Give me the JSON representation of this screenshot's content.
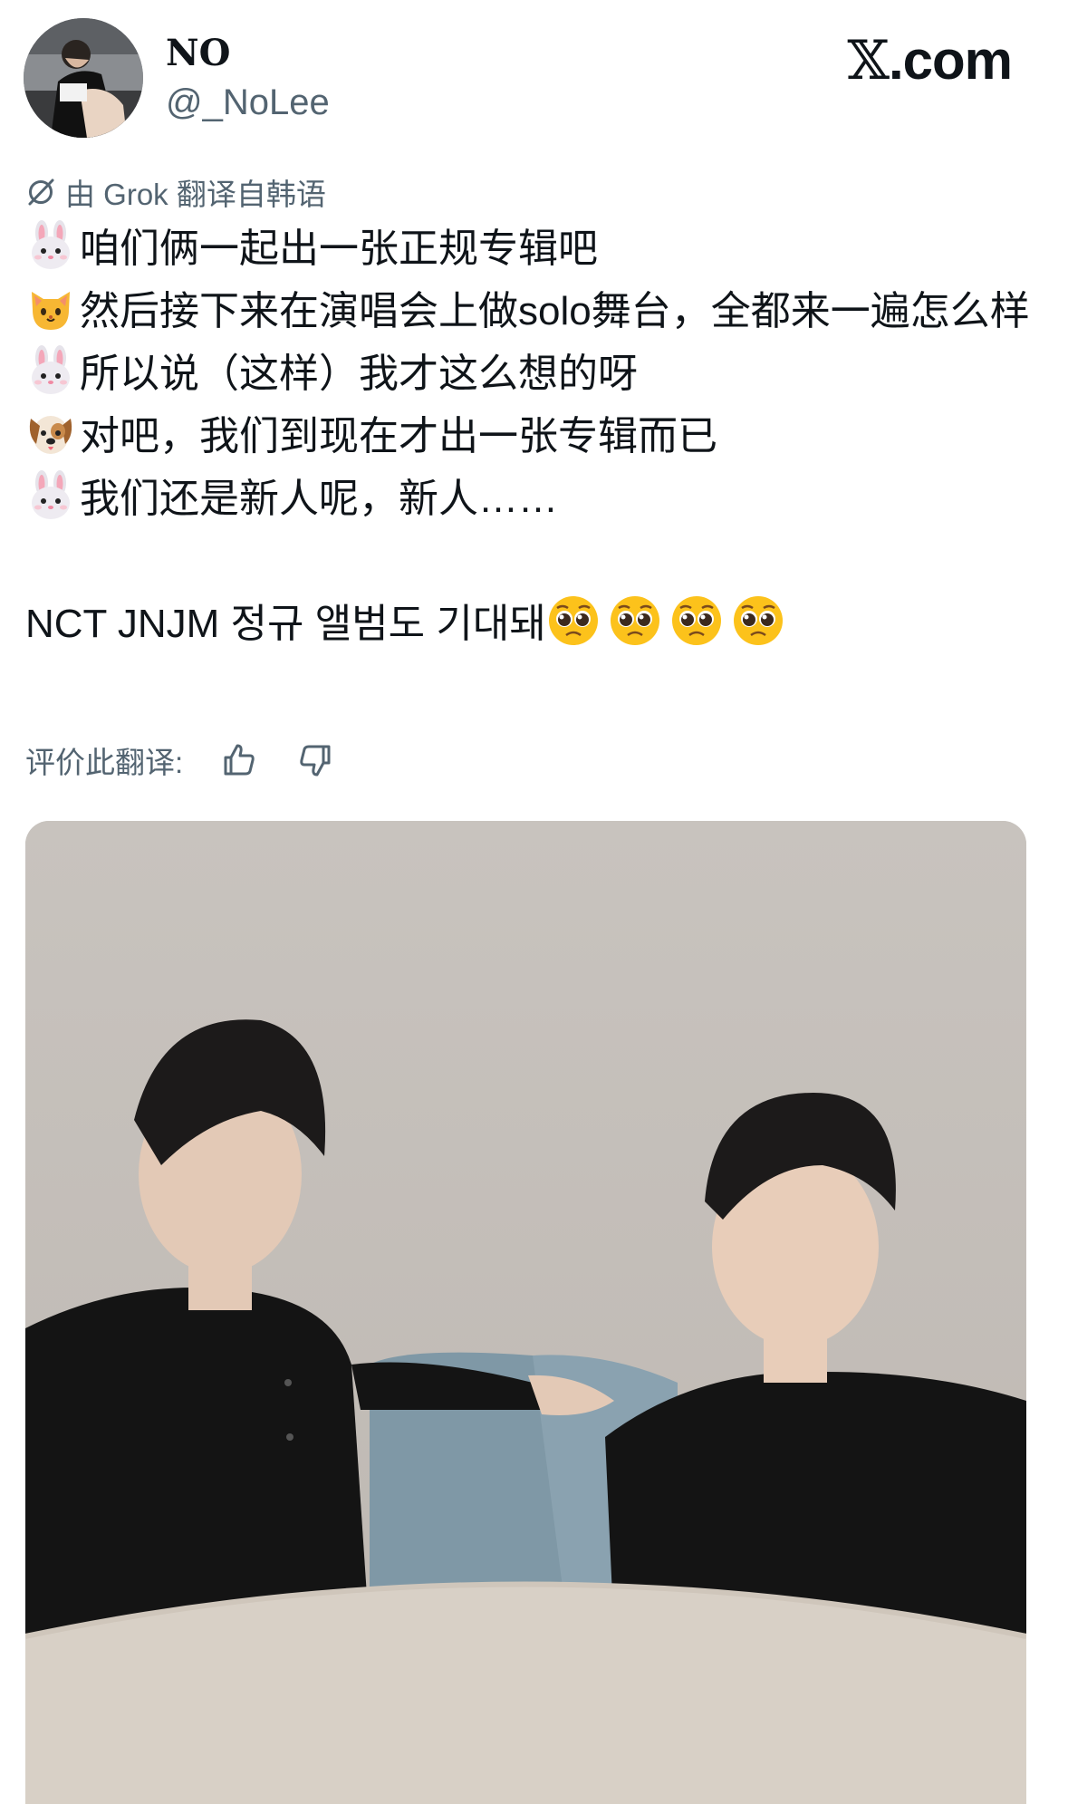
{
  "author": {
    "display_name": "NO",
    "handle": "@_NoLee",
    "avatar_icon": "profile-photo"
  },
  "brand": {
    "mark": "𝕏",
    "suffix": ".com"
  },
  "translation": {
    "note": "由 Grok 翻译自韩语",
    "icon": "grok-icon",
    "rate_label": "评价此翻译:",
    "thumbs_up_icon": "thumbs-up-icon",
    "thumbs_down_icon": "thumbs-down-icon"
  },
  "post": {
    "lines": [
      {
        "emoji": "rabbit-face",
        "text": "咱们俩一起出一张正规专辑吧"
      },
      {
        "emoji": "cat-face",
        "text": "然后接下来在演唱会上做solo舞台，全都来一遍怎么样"
      },
      {
        "emoji": "rabbit-face",
        "text": "所以说（这样）我才这么想的呀"
      },
      {
        "emoji": "dog-face",
        "text": "对吧，我们到现在才出一张专辑而已"
      },
      {
        "emoji": "rabbit-face",
        "text": "我们还是新人呢，新人……"
      }
    ],
    "korean_text": "NCT JNJM 정규 앨범도 기대돼",
    "trailing_emoji": [
      "pleading-face",
      "pleading-face",
      "pleading-face",
      "pleading-face"
    ]
  },
  "media": {
    "type": "video-thumbnail",
    "colors": {
      "wall": "#c9c4bf",
      "sofa": "#7f98a6",
      "clothing": "#141414",
      "table": "#d8d0c6"
    }
  }
}
